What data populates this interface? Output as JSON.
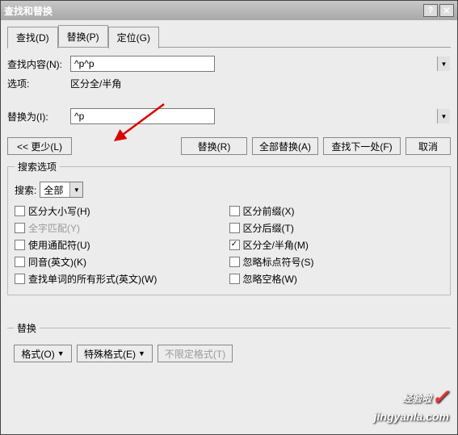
{
  "window": {
    "title": "查找和替换"
  },
  "tabs": [
    {
      "label": "查找(D)"
    },
    {
      "label": "替换(P)"
    },
    {
      "label": "定位(G)"
    }
  ],
  "find": {
    "label": "查找内容(N):",
    "value": "^p^p"
  },
  "options_label": "选项:",
  "options_value": "区分全/半角",
  "replace": {
    "label": "替换为(I):",
    "value": "^p"
  },
  "buttons": {
    "less": "<< 更少(L)",
    "replace_one": "替换(R)",
    "replace_all": "全部替换(A)",
    "find_next": "查找下一处(F)",
    "cancel": "取消"
  },
  "search_options": {
    "legend": "搜索选项",
    "search_label": "搜索:",
    "search_value": "全部",
    "left": [
      {
        "label": "区分大小写(H)",
        "checked": false,
        "disabled": false
      },
      {
        "label": "全字匹配(Y)",
        "checked": false,
        "disabled": true
      },
      {
        "label": "使用通配符(U)",
        "checked": false,
        "disabled": false
      },
      {
        "label": "同音(英文)(K)",
        "checked": false,
        "disabled": false
      },
      {
        "label": "查找单词的所有形式(英文)(W)",
        "checked": false,
        "disabled": false
      }
    ],
    "right": [
      {
        "label": "区分前缀(X)",
        "checked": false
      },
      {
        "label": "区分后缀(T)",
        "checked": false
      },
      {
        "label": "区分全/半角(M)",
        "checked": true
      },
      {
        "label": "忽略标点符号(S)",
        "checked": false
      },
      {
        "label": "忽略空格(W)",
        "checked": false
      }
    ]
  },
  "replace_group": {
    "legend": "替换",
    "format": "格式(O)",
    "special": "特殊格式(E)",
    "noformat": "不限定格式(T)"
  },
  "watermark": {
    "line1": "经验啦",
    "line2": "jingyanla.com"
  }
}
